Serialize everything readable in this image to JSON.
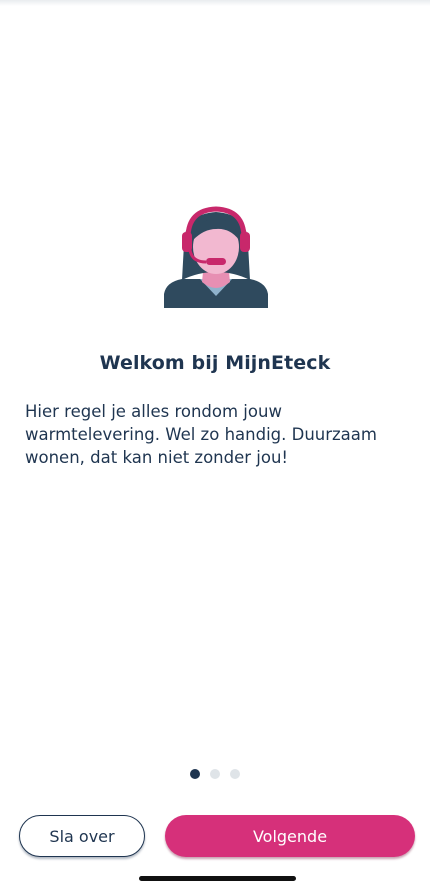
{
  "onboarding": {
    "illustration_icon": "support-agent-headset-icon",
    "title": "Welkom bij MijnEteck",
    "body": "Hier regel je alles rondom jouw warmtelevering. Wel zo handig. Duurzaam wonen, dat kan niet zonder jou!",
    "page_indicator": {
      "current": 1,
      "total": 3
    }
  },
  "actions": {
    "skip_label": "Sla over",
    "next_label": "Volgende"
  },
  "colors": {
    "primary": "#d6307a",
    "text": "#1f3550",
    "dot_inactive": "#dfe4e8"
  }
}
